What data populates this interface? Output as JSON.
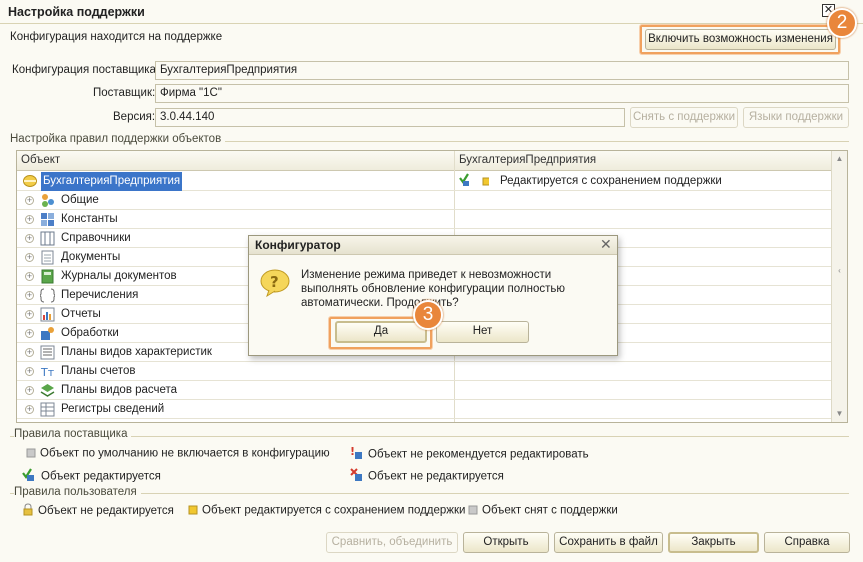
{
  "window": {
    "title": "Настройка поддержки",
    "close_glyph": "✕"
  },
  "header": {
    "status": "Конфигурация находится на поддержке",
    "enable_button": "Включить возможность изменения",
    "badge_number": "2"
  },
  "info": {
    "vendor_config_label": "Конфигурация поставщика:",
    "vendor_config_value": "БухгалтерияПредприятия",
    "vendor_label": "Поставщик:",
    "vendor_value": "Фирма \"1С\"",
    "version_label": "Версия:",
    "version_value": "3.0.44.140",
    "remove_support_button": "Снять с поддержки",
    "languages_button": "Языки поддержки"
  },
  "rules_group": {
    "title": "Настройка правил поддержки объектов",
    "columns": [
      "Объект",
      "БухгалтерияПредприятия"
    ],
    "rows": [
      {
        "name": "БухгалтерияПредприятия",
        "icon": "config-icon",
        "rule": "Редактируется с сохранением поддержки",
        "selected": true
      },
      {
        "name": "Общие",
        "icon": "common-icon",
        "rule": ""
      },
      {
        "name": "Константы",
        "icon": "constants-icon",
        "rule": ""
      },
      {
        "name": "Справочники",
        "icon": "catalogs-icon",
        "rule": ""
      },
      {
        "name": "Документы",
        "icon": "documents-icon",
        "rule": ""
      },
      {
        "name": "Журналы документов",
        "icon": "journals-icon",
        "rule": ""
      },
      {
        "name": "Перечисления",
        "icon": "enums-icon",
        "rule": ""
      },
      {
        "name": "Отчеты",
        "icon": "reports-icon",
        "rule": ""
      },
      {
        "name": "Обработки",
        "icon": "processing-icon",
        "rule": ""
      },
      {
        "name": "Планы видов характеристик",
        "icon": "char-plans-icon",
        "rule": ""
      },
      {
        "name": "Планы счетов",
        "icon": "accounts-icon",
        "rule": ""
      },
      {
        "name": "Планы видов расчета",
        "icon": "calc-plans-icon",
        "rule": ""
      },
      {
        "name": "Регистры сведений",
        "icon": "info-registers-icon",
        "rule": ""
      }
    ]
  },
  "vendor_rules": {
    "title": "Правила поставщика",
    "items": [
      "Объект по умолчанию не включается в конфигурацию",
      "Объект не рекомендуется редактировать",
      "Объект редактируется",
      "Объект не редактируется"
    ]
  },
  "user_rules": {
    "title": "Правила пользователя",
    "items": [
      "Объект не редактируется",
      "Объект редактируется с сохранением поддержки",
      "Объект снят с поддержки"
    ]
  },
  "footer": {
    "compare_button": "Сравнить, объединить",
    "open_button": "Открыть",
    "save_button": "Сохранить в файл",
    "close_button": "Закрыть",
    "help_button": "Справка"
  },
  "dialog": {
    "title": "Конфигуратор",
    "message": "Изменение режима приведет к невозможности выполнять обновление конфигурации полностью автоматически. Продолжить?",
    "yes_button": "Да",
    "no_button": "Нет",
    "badge_number": "3",
    "close_glyph": "✕"
  },
  "colors": {
    "accent": "#e9863b",
    "selection": "#3b75c9",
    "background": "#fbfaf3"
  }
}
